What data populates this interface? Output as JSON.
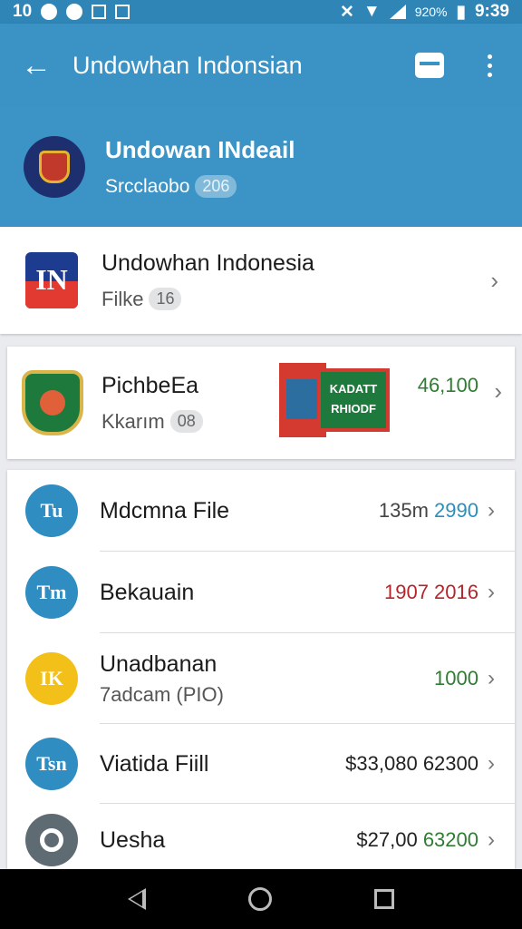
{
  "status_bar": {
    "time_left": "10",
    "battery_percent": "920%",
    "clock": "9:39"
  },
  "app_bar": {
    "title": "Undowhan Indonsian"
  },
  "header": {
    "title": "Undowan INdeail",
    "subtitle": "Srcclaobo",
    "badge": "206"
  },
  "account_card": {
    "logo_text": "IN",
    "title": "Undowhan Indonesia",
    "subtitle": "Filke",
    "badge": "16"
  },
  "promo_card": {
    "title": "PichbeEa",
    "subtitle": "Kkarım",
    "badge": "08",
    "promo_lines": [
      "KADATT",
      "RHIODF"
    ],
    "amount": "46,100",
    "amount_color": "#2e7d32"
  },
  "list": [
    {
      "avatar": "Tu",
      "avatar_color": "#2f8dc1",
      "title": "Mdcmna File",
      "subtitle": "",
      "amount_prefix": "135m",
      "amount": "2990",
      "amount_color": "#2a8fbd"
    },
    {
      "avatar": "Tm",
      "avatar_color": "#2f8dc1",
      "title": "Bekauain",
      "subtitle": "",
      "amount_prefix": "",
      "amount": "1907 2016",
      "amount_color": "#b3262b"
    },
    {
      "avatar": "IK",
      "avatar_color": "#f2c018",
      "title": "Unadbanan",
      "subtitle": "7adcam (PIO)",
      "amount_prefix": "",
      "amount": "1000",
      "amount_color": "#2e7d32"
    },
    {
      "avatar": "Tsn",
      "avatar_color": "#2f8dc1",
      "title": "Viatida Fiill",
      "subtitle": "",
      "amount_prefix": "$33,080",
      "amount": "62300",
      "amount_color": "#222222"
    },
    {
      "avatar": "",
      "avatar_color": "#5f6b73",
      "title": "Uesha",
      "subtitle": "",
      "amount_prefix": "$27,00",
      "amount": "63200",
      "amount_color": "#2e7d32"
    }
  ],
  "icons": {
    "back": "arrow-left",
    "briefcase": "briefcase",
    "more": "vertical-dots",
    "chevron": "chevron-right",
    "nav_back": "triangle-left",
    "nav_home": "circle",
    "nav_recent": "square"
  }
}
